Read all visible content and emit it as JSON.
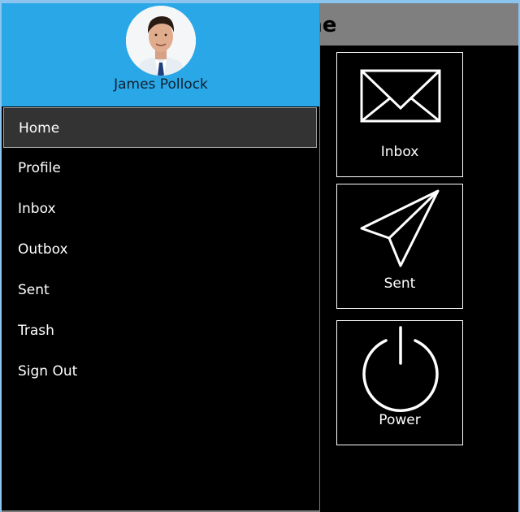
{
  "page": {
    "title": "Home"
  },
  "tiles": [
    {
      "label": "Inbox",
      "icon": "envelope-icon"
    },
    {
      "label": "Sent",
      "icon": "paper-plane-icon"
    },
    {
      "label": "Power",
      "icon": "power-icon"
    }
  ],
  "drawer": {
    "user_name": "James Pollock",
    "avatar": "user-avatar",
    "menu": [
      {
        "label": "Home",
        "active": true
      },
      {
        "label": "Profile"
      },
      {
        "label": "Inbox"
      },
      {
        "label": "Outbox"
      },
      {
        "label": "Sent"
      },
      {
        "label": "Trash"
      },
      {
        "label": "Sign Out"
      }
    ]
  },
  "colors": {
    "drawer_header": "#2aa7e6",
    "page_header": "#7f7f7f",
    "active_item": "#333333"
  }
}
